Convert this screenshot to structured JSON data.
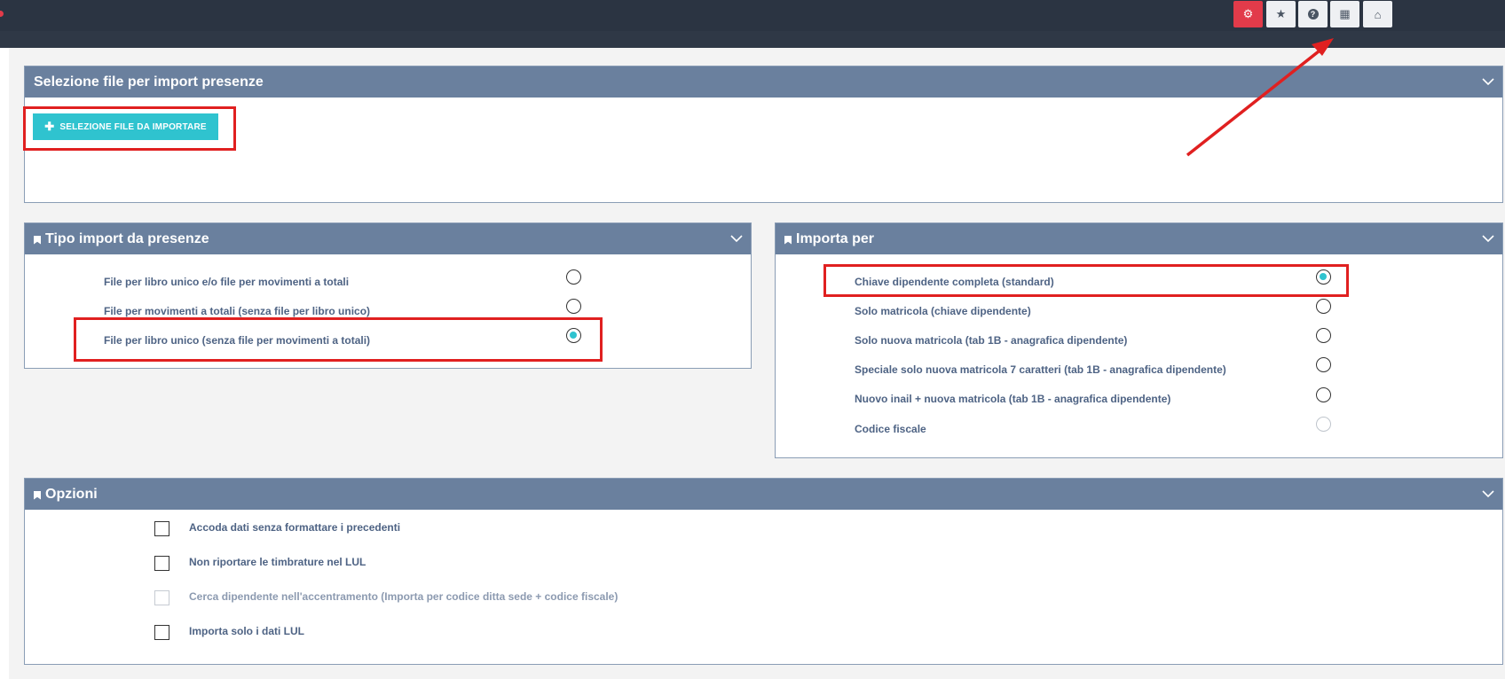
{
  "toolbar": {
    "buttons": [
      {
        "icon": "gear-icon",
        "glyph": "⚙",
        "active": true
      },
      {
        "icon": "star-icon",
        "glyph": "★",
        "active": false
      },
      {
        "icon": "help-icon",
        "glyph": "?",
        "active": false
      },
      {
        "icon": "grid-icon",
        "glyph": "▦",
        "active": false
      },
      {
        "icon": "home-icon",
        "glyph": "⌂",
        "active": false
      }
    ]
  },
  "file_panel": {
    "title": "Selezione file per import presenze",
    "button_label": "SELEZIONE FILE DA IMPORTARE"
  },
  "tipo_panel": {
    "title": "Tipo import da presenze",
    "options": [
      {
        "label": "File per libro unico e/o file per movimenti a totali",
        "checked": false
      },
      {
        "label": "File per movimenti a totali (senza file per libro unico)",
        "checked": false
      },
      {
        "label": "File per libro unico (senza file per movimenti a totali)",
        "checked": true
      }
    ]
  },
  "importa_panel": {
    "title": "Importa per",
    "options": [
      {
        "label": "Chiave dipendente completa (standard)",
        "checked": true,
        "disabled": false
      },
      {
        "label": "Solo matricola (chiave dipendente)",
        "checked": false,
        "disabled": false
      },
      {
        "label": "Solo nuova matricola (tab 1B - anagrafica dipendente)",
        "checked": false,
        "disabled": false
      },
      {
        "label": "Speciale solo nuova matricola 7 caratteri (tab 1B - anagrafica dipendente)",
        "checked": false,
        "disabled": false
      },
      {
        "label": "Nuovo inail + nuova matricola (tab 1B - anagrafica dipendente)",
        "checked": false,
        "disabled": false
      },
      {
        "label": "Codice fiscale",
        "checked": false,
        "disabled": true
      }
    ]
  },
  "opzioni_panel": {
    "title": "Opzioni",
    "options": [
      {
        "label": "Accoda dati senza formattare i precedenti",
        "checked": false,
        "disabled": false
      },
      {
        "label": "Non riportare le timbrature nel LUL",
        "checked": false,
        "disabled": false
      },
      {
        "label": "Cerca dipendente nell'accentramento (Importa per codice ditta sede + codice fiscale)",
        "checked": false,
        "disabled": true
      },
      {
        "label": "Importa solo i dati LUL",
        "checked": false,
        "disabled": false
      }
    ]
  },
  "colors": {
    "header": "#6a809e",
    "accent": "#2fc3cf",
    "highlight": "#e02020",
    "topbar": "#2b3442"
  }
}
